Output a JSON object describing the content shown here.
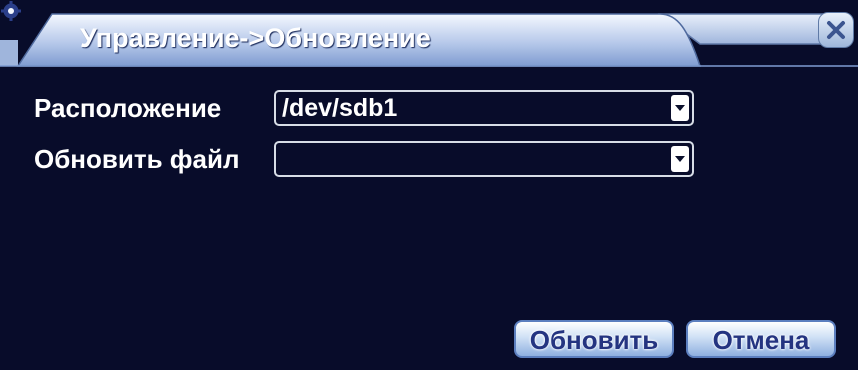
{
  "dialog": {
    "title": "Управление->Обновление",
    "title_icon": "gear-icon",
    "close_icon": "close-icon"
  },
  "form": {
    "location_label": "Расположение",
    "location_value": "/dev/sdb1",
    "file_label": "Обновить файл",
    "file_value": ""
  },
  "buttons": {
    "update_label": "Обновить",
    "cancel_label": "Отмена"
  },
  "colors": {
    "background": "#080c2a",
    "titlebar": "#c9d7ef",
    "text": "#ffffff",
    "button_text": "#243481"
  }
}
